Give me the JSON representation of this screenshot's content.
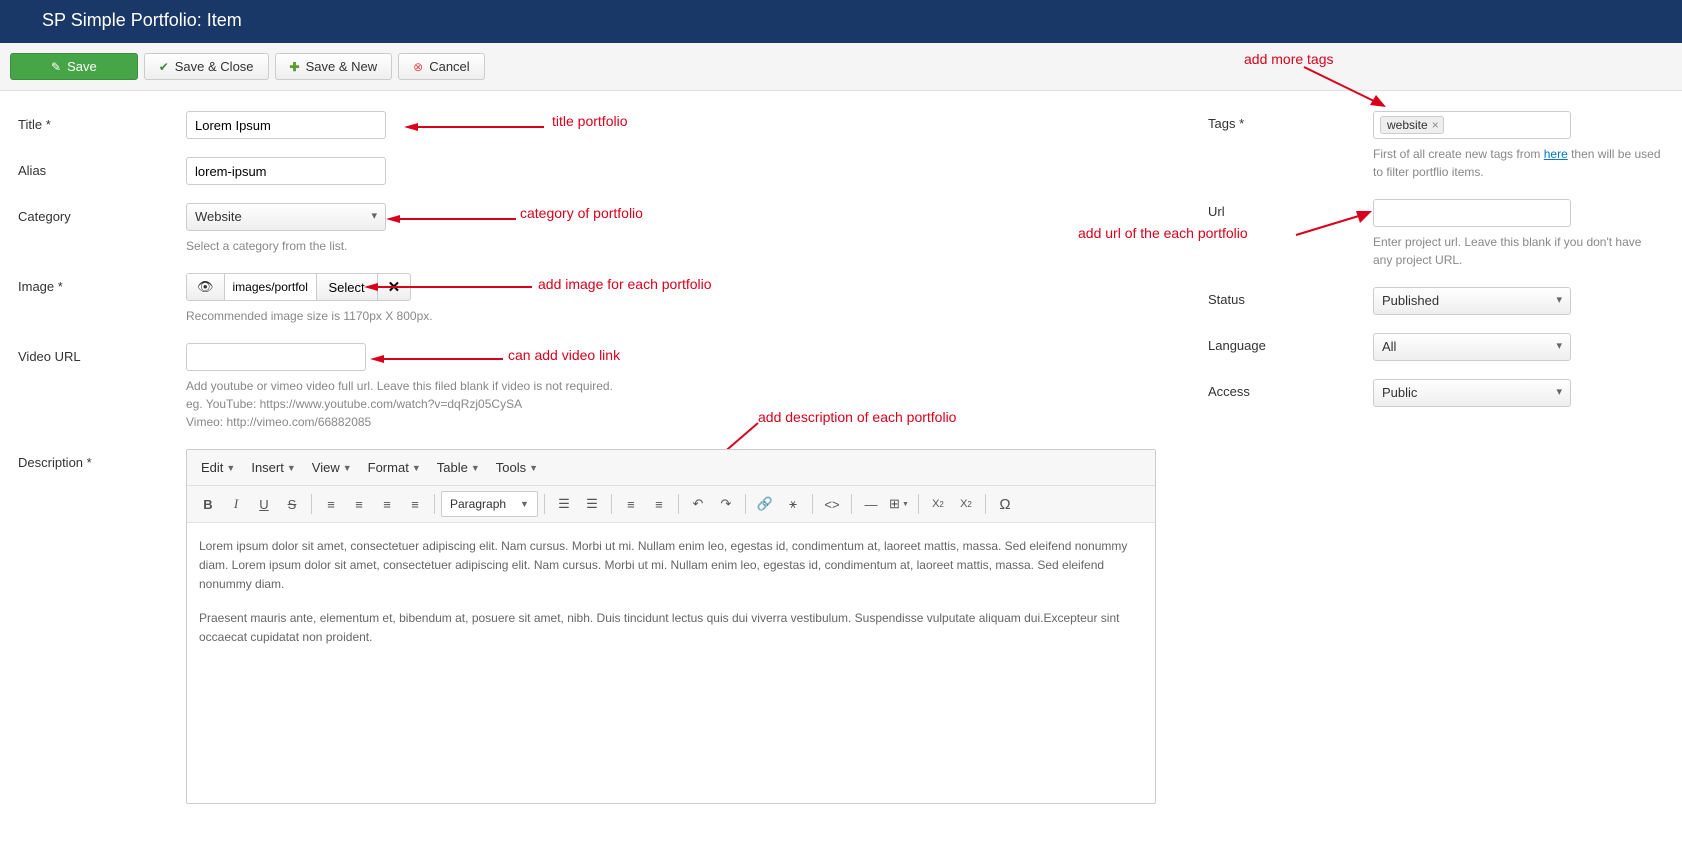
{
  "header": {
    "title": "SP Simple Portfolio: Item"
  },
  "toolbar": {
    "save": "Save",
    "save_close": "Save & Close",
    "save_new": "Save & New",
    "cancel": "Cancel"
  },
  "form": {
    "title_label": "Title *",
    "title_value": "Lorem Ipsum",
    "alias_label": "Alias",
    "alias_value": "lorem-ipsum",
    "category_label": "Category",
    "category_value": "Website",
    "category_help": "Select a category from the list.",
    "image_label": "Image *",
    "image_path": "images/portfolio",
    "image_select": "Select",
    "image_help": "Recommended image size is 1170px X 800px.",
    "video_label": "Video URL",
    "video_value": "",
    "video_help_1": "Add youtube or vimeo video full url. Leave this filed blank if video is not required.",
    "video_help_2": "eg. YouTube: https://www.youtube.com/watch?v=dqRzj05CySA",
    "video_help_3": "Vimeo: http://vimeo.com/66882085",
    "description_label": "Description *"
  },
  "editor": {
    "menu": {
      "edit": "Edit",
      "insert": "Insert",
      "view": "View",
      "format": "Format",
      "table": "Table",
      "tools": "Tools"
    },
    "format_dropdown": "Paragraph",
    "content_p1": "Lorem ipsum dolor sit amet, consectetuer adipiscing elit. Nam cursus. Morbi ut mi. Nullam enim leo, egestas id, condimentum at, laoreet mattis, massa. Sed eleifend nonummy diam. Lorem ipsum dolor sit amet, consectetuer adipiscing elit. Nam cursus. Morbi ut mi. Nullam enim leo, egestas id, condimentum at, laoreet mattis, massa. Sed eleifend nonummy diam.",
    "content_p2": "Praesent mauris ante, elementum et, bibendum at, posuere sit amet, nibh. Duis tincidunt lectus quis dui viverra vestibulum. Suspendisse vulputate aliquam dui.Excepteur sint occaecat cupidatat non proident."
  },
  "sidebar": {
    "tags_label": "Tags *",
    "tag_value": "website",
    "tags_help_prefix": "First of all create new tags from ",
    "tags_help_link": "here",
    "tags_help_suffix": " then will be used to filter portflio items.",
    "url_label": "Url",
    "url_value": "",
    "url_help": "Enter project url. Leave this blank if you don't have any project URL.",
    "status_label": "Status",
    "status_value": "Published",
    "language_label": "Language",
    "language_value": "All",
    "access_label": "Access",
    "access_value": "Public"
  },
  "annotations": {
    "title": "title portfolio",
    "category": "category of portfolio",
    "image": "add image for each portfolio",
    "video": "can add video link",
    "description": "add description of each portfolio",
    "tags": "add more tags",
    "url": "add url of the each portfolio"
  }
}
